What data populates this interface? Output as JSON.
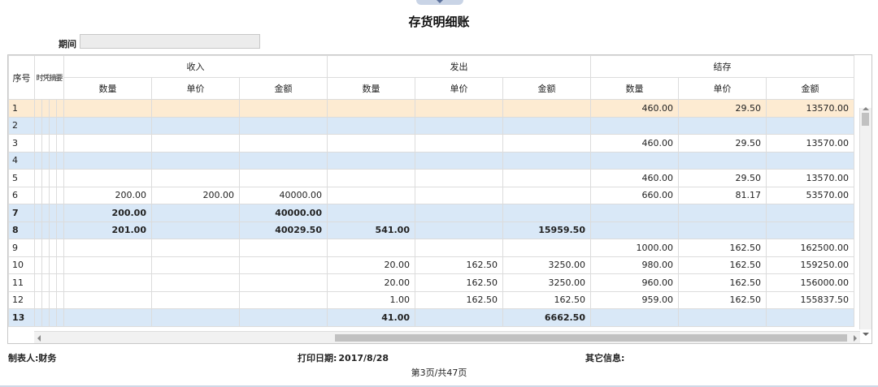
{
  "title": "存货明细账",
  "period": {
    "label": "期间",
    "value": ""
  },
  "table": {
    "seq_header": "序号",
    "narrow_headers": [
      "时",
      "凭",
      "摘",
      "要"
    ],
    "groups": [
      "收入",
      "发出",
      "结存"
    ],
    "subheaders": [
      "数量",
      "单价",
      "金额",
      "数量",
      "单价",
      "金额",
      "数量",
      "单价",
      "金额"
    ],
    "rows": [
      {
        "seq": "1",
        "cells": [
          "",
          "",
          "",
          "",
          "",
          "",
          "460.00",
          "29.50",
          "13570.00"
        ],
        "style": "orange"
      },
      {
        "seq": "2",
        "cells": [
          "",
          "",
          "",
          "",
          "",
          "",
          "",
          "",
          ""
        ],
        "style": "blue"
      },
      {
        "seq": "3",
        "cells": [
          "",
          "",
          "",
          "",
          "",
          "",
          "460.00",
          "29.50",
          "13570.00"
        ],
        "style": ""
      },
      {
        "seq": "4",
        "cells": [
          "",
          "",
          "",
          "",
          "",
          "",
          "",
          "",
          ""
        ],
        "style": "blue"
      },
      {
        "seq": "5",
        "cells": [
          "",
          "",
          "",
          "",
          "",
          "",
          "460.00",
          "29.50",
          "13570.00"
        ],
        "style": ""
      },
      {
        "seq": "6",
        "cells": [
          "200.00",
          "200.00",
          "40000.00",
          "",
          "",
          "",
          "660.00",
          "81.17",
          "53570.00"
        ],
        "style": ""
      },
      {
        "seq": "7",
        "cells": [
          "200.00",
          "",
          "40000.00",
          "",
          "",
          "",
          "",
          "",
          ""
        ],
        "style": "blue bold"
      },
      {
        "seq": "8",
        "cells": [
          "201.00",
          "",
          "40029.50",
          "541.00",
          "",
          "15959.50",
          "",
          "",
          ""
        ],
        "style": "blue bold"
      },
      {
        "seq": "9",
        "cells": [
          "",
          "",
          "",
          "",
          "",
          "",
          "1000.00",
          "162.50",
          "162500.00"
        ],
        "style": ""
      },
      {
        "seq": "10",
        "cells": [
          "",
          "",
          "",
          "20.00",
          "162.50",
          "3250.00",
          "980.00",
          "162.50",
          "159250.00"
        ],
        "style": ""
      },
      {
        "seq": "11",
        "cells": [
          "",
          "",
          "",
          "20.00",
          "162.50",
          "3250.00",
          "960.00",
          "162.50",
          "156000.00"
        ],
        "style": ""
      },
      {
        "seq": "12",
        "cells": [
          "",
          "",
          "",
          "1.00",
          "162.50",
          "162.50",
          "959.00",
          "162.50",
          "155837.50"
        ],
        "style": ""
      },
      {
        "seq": "13",
        "cells": [
          "",
          "",
          "",
          "41.00",
          "",
          "6662.50",
          "",
          "",
          ""
        ],
        "style": "blue bold"
      }
    ]
  },
  "footer": {
    "maker_label": "制表人:",
    "maker_value": "财务",
    "print_label": "打印日期:",
    "print_value": "2017/8/28",
    "other_label": "其它信息:",
    "page_text": "第3页/共47页"
  },
  "colors": {
    "orange_row": "#fdebd2",
    "blue_row": "#d9e8f7",
    "grid_line": "#dcdcdc"
  },
  "icons": [
    "chevron-down-icon",
    "scroll-up-icon",
    "scroll-down-icon",
    "scroll-left-icon",
    "scroll-right-icon"
  ]
}
